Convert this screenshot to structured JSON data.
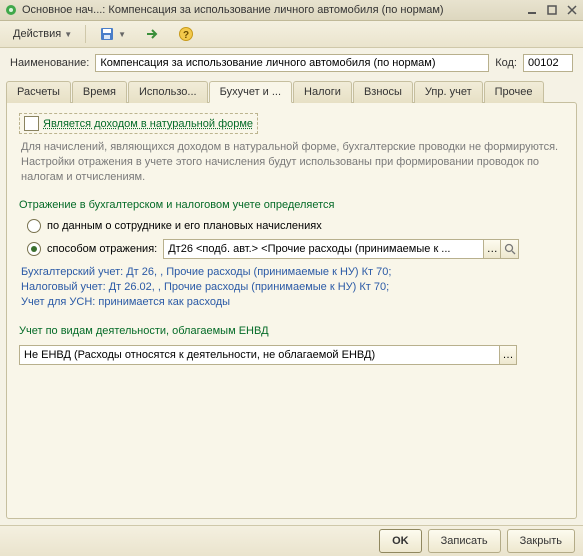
{
  "window": {
    "title": "Основное нач...: Компенсация за использование личного автомобиля (по нормам)"
  },
  "toolbar": {
    "actions": "Действия"
  },
  "header": {
    "name_label": "Наименование:",
    "name_value": "Компенсация за использование личного автомобиля (по нормам)",
    "code_label": "Код:",
    "code_value": "00102"
  },
  "tabs": [
    "Расчеты",
    "Время",
    "Использо...",
    "Бухучет и ...",
    "Налоги",
    "Взносы",
    "Упр. учет",
    "Прочее"
  ],
  "page": {
    "natural_label": "Является доходом в натуральной форме",
    "natural_hint": "Для начислений, являющихся доходом в натуральной форме, бухгалтерские проводки не формируются. Настройки отражения в учете этого начисления будут использованы при формировании проводок по налогам и отчислениям.",
    "reflection_title": "Отражение в бухгалтерском и налоговом учете определяется",
    "radio1": "по данным о сотруднике и его плановых начислениях",
    "radio2": "способом отражения:",
    "method_value": "Дт26 <подб. авт.> <Прочие расходы (принимаемые к ...",
    "info": [
      "Бухгалтерский учет: Дт 26, , Прочие расходы (принимаемые к НУ) Кт 70;",
      "Налоговый учет: Дт 26.02, , Прочие расходы (принимаемые к НУ) Кт 70;",
      "Учет для УСН: принимается как расходы"
    ],
    "envd_title": "Учет по видам деятельности, облагаемым ЕНВД",
    "envd_value": "Не ЕНВД (Расходы относятся к деятельности, не облагаемой ЕНВД)"
  },
  "footer": {
    "ok": "OK",
    "write": "Записать",
    "close": "Закрыть"
  }
}
